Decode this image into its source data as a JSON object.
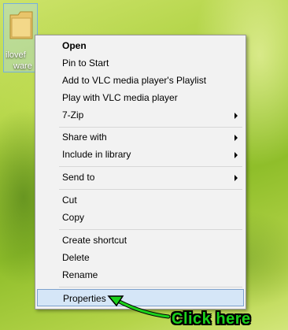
{
  "desktop_icon": {
    "label_line1": "ilovef",
    "label_line2": "ware"
  },
  "context_menu": {
    "open": "Open",
    "pin_to_start": "Pin to Start",
    "add_to_vlc_playlist": "Add to VLC media player's Playlist",
    "play_with_vlc": "Play with VLC media player",
    "seven_zip": "7-Zip",
    "share_with": "Share with",
    "include_in_library": "Include in library",
    "send_to": "Send to",
    "cut": "Cut",
    "copy": "Copy",
    "create_shortcut": "Create shortcut",
    "delete": "Delete",
    "rename": "Rename",
    "properties": "Properties"
  },
  "annotation": {
    "text": "Click here",
    "color": "#1bd11b"
  }
}
